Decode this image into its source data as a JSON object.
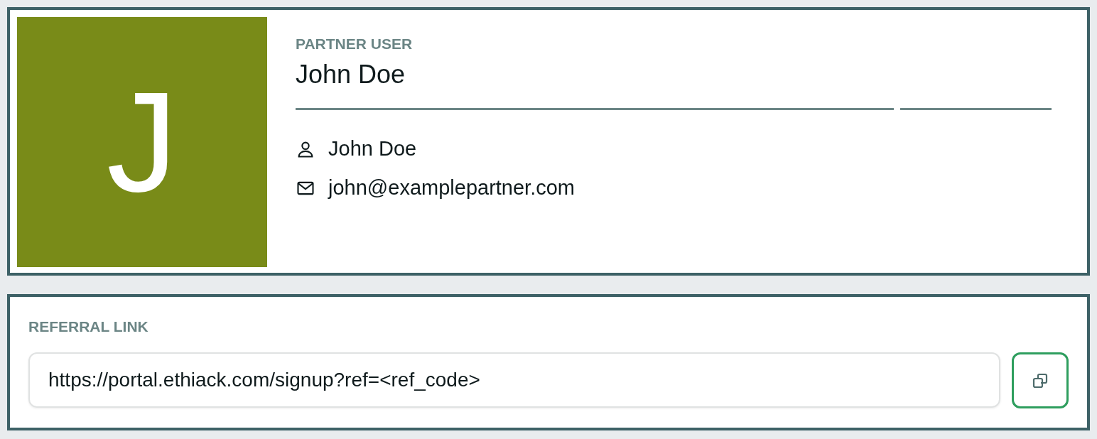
{
  "profile": {
    "avatar_letter": "J",
    "role": "PARTNER USER",
    "name": "John Doe",
    "details": [
      {
        "kind": "person",
        "text": "John Doe"
      },
      {
        "kind": "email",
        "text": "john@examplepartner.com"
      }
    ]
  },
  "referral": {
    "label": "REFERRAL LINK",
    "value": "https://portal.ethiack.com/signup?ref=<ref_code>"
  }
}
